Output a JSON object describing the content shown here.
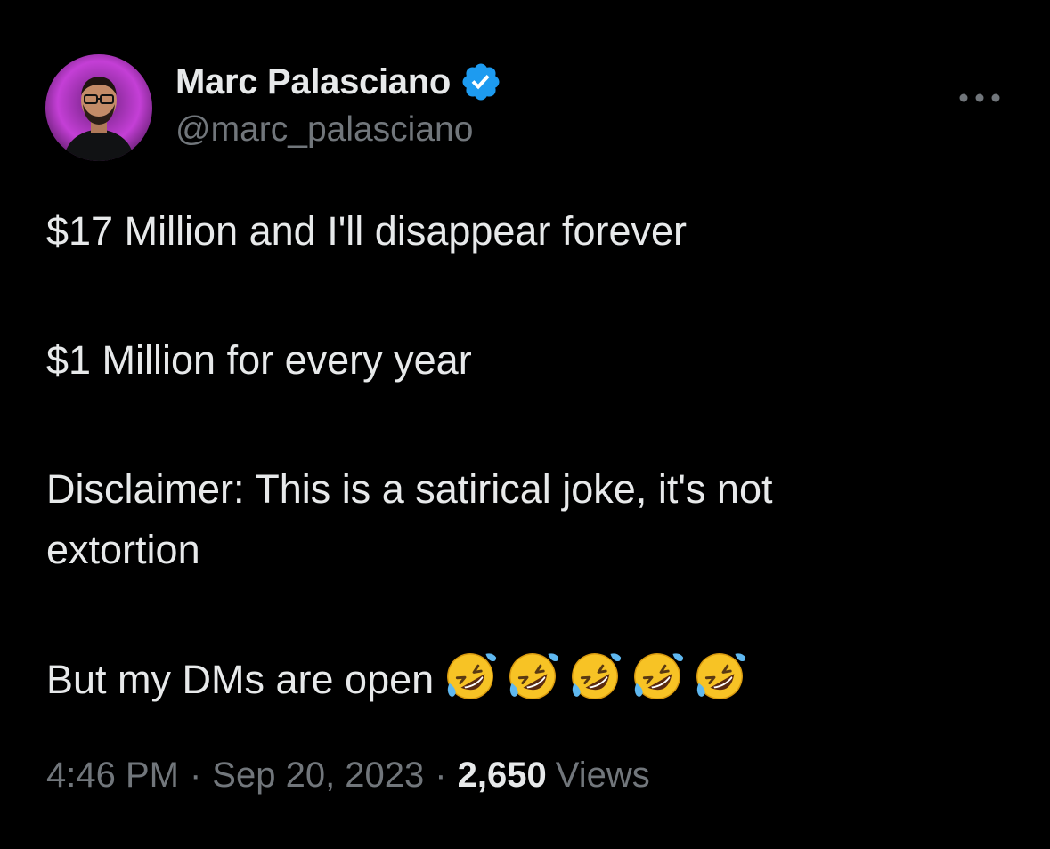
{
  "author": {
    "name": "Marc Palasciano",
    "handle": "@marc_palasciano",
    "verified": true,
    "avatar_icon": "profile-photo",
    "verified_icon": "verified-badge-icon"
  },
  "tweet": {
    "line1": "$17 Million and I'll disappear forever",
    "line2": "$1 Million for every year",
    "line3a": "Disclaimer: This is a satirical joke, it's not",
    "line3b": "extortion",
    "line4": "But my DMs are open",
    "emoji": "rolling-on-the-floor-laughing",
    "emoji_count": 5
  },
  "meta": {
    "time": "4:46 PM",
    "separator": "·",
    "date": "Sep 20, 2023",
    "views_count": "2,650",
    "views_label": "Views"
  },
  "colors": {
    "background": "#000000",
    "text": "#e7e9ea",
    "secondary": "#71767b",
    "verified": "#1d9bf0"
  }
}
